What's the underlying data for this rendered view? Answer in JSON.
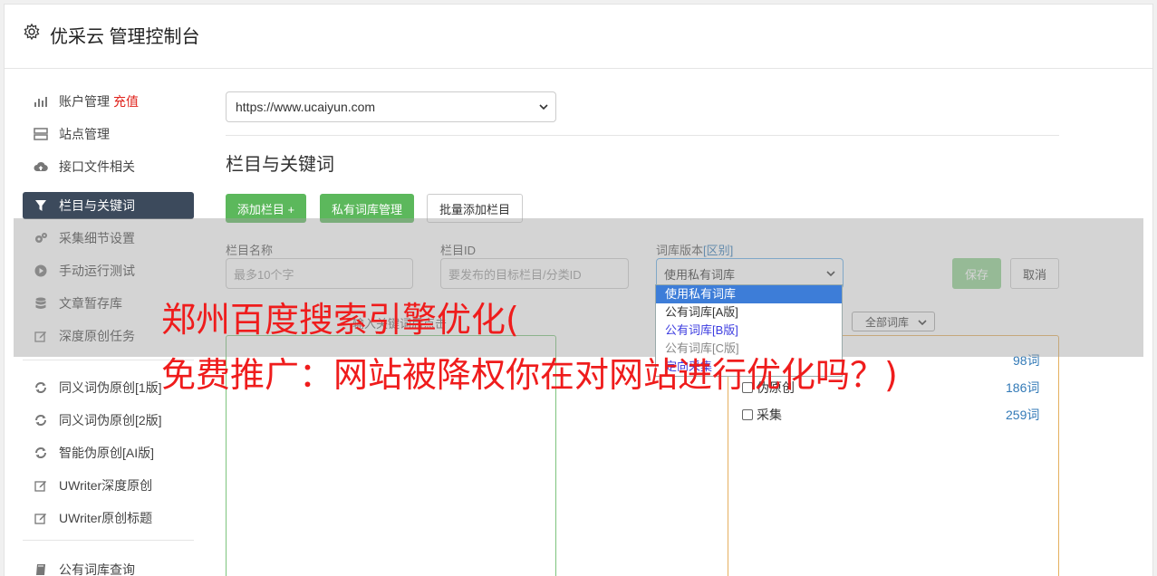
{
  "header": {
    "title": "优采云 管理控制台",
    "icon": "gear-icon"
  },
  "sidebar": {
    "items": [
      {
        "label": "账户管理",
        "extra": "充值",
        "icon": "bar-chart-icon"
      },
      {
        "label": "站点管理",
        "icon": "server-icon"
      },
      {
        "label": "接口文件相关",
        "icon": "cloud-upload-icon"
      },
      {
        "label": "栏目与关键词",
        "icon": "filter-icon",
        "active": true
      },
      {
        "label": "采集细节设置",
        "icon": "cogs-icon"
      },
      {
        "label": "手动运行测试",
        "icon": "play-circle-icon"
      },
      {
        "label": "文章暂存库",
        "icon": "database-icon"
      },
      {
        "label": "深度原创任务",
        "icon": "edit-icon"
      },
      {
        "label": "同义词伪原创[1版]",
        "icon": "refresh-icon"
      },
      {
        "label": "同义词伪原创[2版]",
        "icon": "refresh-icon"
      },
      {
        "label": "智能伪原创[AI版]",
        "icon": "refresh-icon"
      },
      {
        "label": "UWriter深度原创",
        "icon": "edit-icon"
      },
      {
        "label": "UWriter原创标题",
        "icon": "edit-icon"
      },
      {
        "label": "公有词库查询",
        "icon": "book-icon"
      }
    ]
  },
  "main": {
    "site_select": "https://www.ucaiyun.com",
    "section_title": "栏目与关键词",
    "buttons": {
      "add": "添加栏目 +",
      "private_lib": "私有词库管理",
      "batch_add": "批量添加栏目"
    },
    "form": {
      "name_label": "栏目名称",
      "name_placeholder": "最多10个字",
      "id_label": "栏目ID",
      "id_placeholder": "要发布的目标栏目/分类ID",
      "lib_label": "词库版本",
      "lib_link": "[区别]",
      "lib_value": "使用私有词库",
      "save": "保存",
      "cancel": "取消"
    },
    "lib_options": [
      "使用私有词库",
      "公有词库[A版]",
      "公有词库[B版]",
      "公有词库[C版]",
      "定向采集"
    ],
    "hint_text": "输入关键词后点击",
    "all_lib": "全部词库",
    "words": [
      {
        "label": "",
        "count": "98词"
      },
      {
        "label": "伪原创",
        "count": "186词"
      },
      {
        "label": "采集",
        "count": "259词"
      }
    ]
  },
  "overlay": {
    "line1": "郑州百度搜索引擎优化(",
    "line2": "免费推广：网站被降权你在对网站进行优化吗？)"
  }
}
